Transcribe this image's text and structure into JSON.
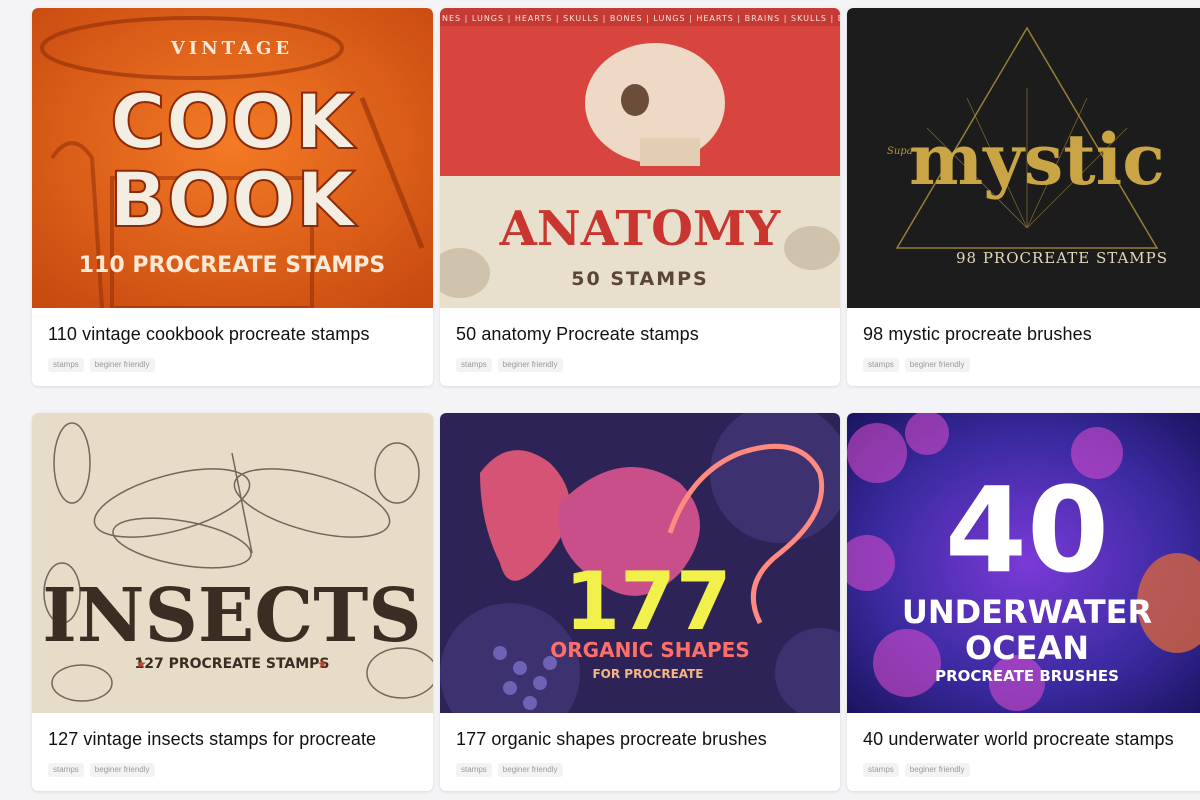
{
  "cards": [
    {
      "title": "110 vintage cookbook procreate stamps",
      "tags": [
        "stamps",
        "beginer friendly"
      ],
      "art": {
        "kicker": "VINTAGE",
        "line1": "COOK",
        "line2": "BOOK",
        "caption": "110 PROCREATE STAMPS",
        "bg": "#e8661c"
      }
    },
    {
      "title": "50 anatomy Procreate stamps",
      "tags": [
        "stamps",
        "beginer friendly"
      ],
      "art": {
        "banner": "NES | LUNGS | HEARTS | SKULLS | BONES | LUNGS | HEARTS | BRAINS | SKULLS | BONES | LU",
        "headline": "ANATOMY",
        "caption": "50 STAMPS",
        "bg": "#d8453f"
      }
    },
    {
      "title": "98 mystic procreate brushes",
      "tags": [
        "stamps",
        "beginer friendly"
      ],
      "art": {
        "small": "Supa",
        "headline": "mystic",
        "caption": "98 PROCREATE STAMPS",
        "bg": "#1c1c1c"
      }
    },
    {
      "title": "127 vintage insects stamps for procreate",
      "tags": [
        "stamps",
        "beginer friendly"
      ],
      "art": {
        "headline": "INSECTS",
        "caption": "127 PROCREATE STAMPS",
        "bg": "#e6dcc7"
      }
    },
    {
      "title": "177 organic shapes procreate brushes",
      "tags": [
        "stamps",
        "beginer friendly"
      ],
      "art": {
        "number": "177",
        "line1": "ORGANIC SHAPES",
        "line2": "FOR PROCREATE",
        "bg": "#2e2356"
      }
    },
    {
      "title": "40 underwater world procreate stamps",
      "tags": [
        "stamps",
        "beginer friendly"
      ],
      "art": {
        "number": "40",
        "line1": "UNDERWATER",
        "line2": "OCEAN",
        "line3": "PROCREATE BRUSHES",
        "bg": "#3a2aa0"
      }
    }
  ]
}
